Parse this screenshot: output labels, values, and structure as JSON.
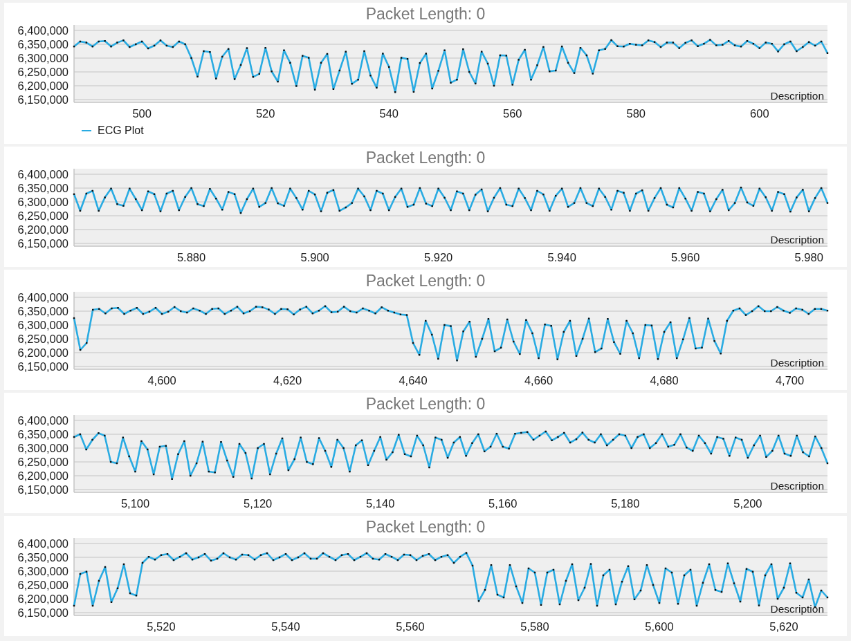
{
  "charts": [
    {
      "title": "Packet Length: 0",
      "description": "Description",
      "chart_data": {
        "type": "line",
        "x": [
          489,
          490,
          491,
          492,
          493,
          494,
          495,
          496,
          497,
          498,
          499,
          500,
          501,
          502,
          503,
          504,
          505,
          506,
          507,
          508,
          509,
          510,
          511,
          512,
          513,
          514,
          515,
          516,
          517,
          518,
          519,
          520,
          521,
          522,
          523,
          524,
          525,
          526,
          527,
          528,
          529,
          530,
          531,
          532,
          533,
          534,
          535,
          536,
          537,
          538,
          539,
          540,
          541,
          542,
          543,
          544,
          545,
          546,
          547,
          548,
          549,
          550,
          551,
          552,
          553,
          554,
          555,
          556,
          557,
          558,
          559,
          560,
          561,
          562,
          563,
          564,
          565,
          566,
          567,
          568,
          569,
          570,
          571,
          572,
          573,
          574,
          575,
          576,
          577,
          578,
          579,
          580,
          581,
          582,
          583,
          584,
          585,
          586,
          587,
          588,
          589,
          590,
          591,
          592,
          593,
          594,
          595,
          596,
          597,
          598,
          599,
          600,
          601,
          602,
          603,
          604,
          605,
          606,
          607,
          608,
          609,
          610,
          611
        ],
        "series": [
          {
            "name": "ECG Plot",
            "color": "#29abe2",
            "marker": true,
            "values": [
              6342000,
              6360000,
              6356000,
              6342000,
              6360000,
              6362000,
              6342000,
              6356000,
              6364000,
              6340000,
              6350000,
              6360000,
              6335000,
              6345000,
              6364000,
              6345000,
              6340000,
              6360000,
              6350000,
              6300000,
              6233000,
              6325000,
              6322000,
              6226000,
              6305000,
              6333000,
              6224000,
              6275000,
              6336000,
              6232000,
              6243000,
              6337000,
              6252000,
              6215000,
              6328000,
              6283000,
              6199000,
              6308000,
              6301000,
              6186000,
              6283000,
              6315000,
              6188000,
              6255000,
              6323000,
              6207000,
              6222000,
              6325000,
              6237000,
              6193000,
              6316000,
              6268000,
              6177000,
              6301000,
              6297000,
              6178000,
              6282000,
              6316000,
              6190000,
              6254000,
              6328000,
              6211000,
              6222000,
              6332000,
              6250000,
              6208000,
              6323000,
              6280000,
              6200000,
              6310000,
              6309000,
              6204000,
              6294000,
              6330000,
              6222000,
              6274000,
              6340000,
              6252000,
              6255000,
              6342000,
              6283000,
              6246000,
              6337000,
              6310000,
              6244000,
              6328000,
              6333000,
              6365000,
              6343000,
              6342000,
              6352000,
              6348000,
              6346000,
              6364000,
              6358000,
              6340000,
              6356000,
              6356000,
              6336000,
              6355000,
              6364000,
              6343000,
              6352000,
              6366000,
              6346000,
              6348000,
              6362000,
              6346000,
              6342000,
              6362000,
              6352000,
              6336000,
              6356000,
              6352000,
              6324000,
              6350000,
              6360000,
              6325000,
              6340000,
              6358000,
              6345000,
              6360000,
              6318000
            ]
          }
        ],
        "grid": true,
        "xlim": [
          489,
          611
        ],
        "ylim": [
          6140000,
          6420000
        ],
        "xticks": [
          500,
          520,
          540,
          560,
          580,
          600
        ],
        "yticks": [
          {
            "value": 6150000,
            "label": "6,150,000"
          },
          {
            "value": 6200000,
            "label": "6,200,000"
          },
          {
            "value": 6250000,
            "label": "6,250,000"
          },
          {
            "value": 6300000,
            "label": "6,300,000"
          },
          {
            "value": 6350000,
            "label": "6,350,000"
          },
          {
            "value": 6400000,
            "label": "6,400,000"
          }
        ]
      }
    },
    {
      "title": "Packet Length: 0",
      "description": "Description",
      "chart_data": {
        "type": "line",
        "x": [
          5.861,
          5.862,
          5.863,
          5.864,
          5.865,
          5.866,
          5.867,
          5.868,
          5.869,
          5.87,
          5.871,
          5.872,
          5.873,
          5.874,
          5.875,
          5.876,
          5.877,
          5.878,
          5.879,
          5.88,
          5.881,
          5.882,
          5.883,
          5.884,
          5.885,
          5.886,
          5.887,
          5.888,
          5.889,
          5.89,
          5.891,
          5.892,
          5.893,
          5.894,
          5.895,
          5.896,
          5.897,
          5.898,
          5.899,
          5.9,
          5.901,
          5.902,
          5.903,
          5.904,
          5.905,
          5.906,
          5.907,
          5.908,
          5.909,
          5.91,
          5.911,
          5.912,
          5.913,
          5.914,
          5.915,
          5.916,
          5.917,
          5.918,
          5.919,
          5.92,
          5.921,
          5.922,
          5.923,
          5.924,
          5.925,
          5.926,
          5.927,
          5.928,
          5.929,
          5.93,
          5.931,
          5.932,
          5.933,
          5.934,
          5.935,
          5.936,
          5.937,
          5.938,
          5.939,
          5.94,
          5.941,
          5.942,
          5.943,
          5.944,
          5.945,
          5.946,
          5.947,
          5.948,
          5.949,
          5.95,
          5.951,
          5.952,
          5.953,
          5.954,
          5.955,
          5.956,
          5.957,
          5.958,
          5.959,
          5.96,
          5.961,
          5.962,
          5.963,
          5.964,
          5.965,
          5.966,
          5.967,
          5.968,
          5.969,
          5.97,
          5.971,
          5.972,
          5.973,
          5.974,
          5.975,
          5.976,
          5.977,
          5.978,
          5.979,
          5.98,
          5.981,
          5.982,
          5.983
        ],
        "series": [
          {
            "color": "#29abe2",
            "marker": true,
            "values": [
              6328000,
              6268000,
              6330000,
              6340000,
              6268000,
              6316000,
              6348000,
              6292000,
              6286000,
              6348000,
              6310000,
              6270000,
              6338000,
              6328000,
              6266000,
              6330000,
              6340000,
              6270000,
              6318000,
              6350000,
              6292000,
              6285000,
              6347000,
              6312000,
              6272000,
              6336000,
              6328000,
              6260000,
              6310000,
              6348000,
              6282000,
              6296000,
              6350000,
              6295000,
              6286000,
              6348000,
              6314000,
              6272000,
              6340000,
              6327000,
              6266000,
              6333000,
              6343000,
              6268000,
              6280000,
              6296000,
              6348000,
              6320000,
              6270000,
              6340000,
              6330000,
              6270000,
              6318000,
              6348000,
              6282000,
              6290000,
              6350000,
              6294000,
              6285000,
              6348000,
              6315000,
              6270000,
              6338000,
              6330000,
              6270000,
              6326000,
              6345000,
              6266000,
              6315000,
              6350000,
              6290000,
              6285000,
              6348000,
              6314000,
              6270000,
              6340000,
              6327000,
              6268000,
              6322000,
              6348000,
              6282000,
              6296000,
              6350000,
              6296000,
              6285000,
              6348000,
              6318000,
              6272000,
              6340000,
              6333000,
              6268000,
              6330000,
              6342000,
              6268000,
              6314000,
              6350000,
              6290000,
              6280000,
              6350000,
              6312000,
              6268000,
              6336000,
              6330000,
              6266000,
              6310000,
              6344000,
              6270000,
              6296000,
              6352000,
              6298000,
              6286000,
              6348000,
              6317000,
              6268000,
              6336000,
              6328000,
              6265000,
              6316000,
              6344000,
              6266000,
              6314000,
              6350000,
              6296000
            ]
          }
        ],
        "grid": true,
        "xlim": [
          5.861,
          5.983
        ],
        "ylim": [
          6140000,
          6420000
        ],
        "xticks": [
          {
            "value": 5.88,
            "label": "5.880"
          },
          {
            "value": 5.9,
            "label": "5.900"
          },
          {
            "value": 5.92,
            "label": "5.920"
          },
          {
            "value": 5.94,
            "label": "5.940"
          },
          {
            "value": 5.96,
            "label": "5.960"
          },
          {
            "value": 5.98,
            "label": "5.980"
          }
        ],
        "yticks": [
          {
            "value": 6150000,
            "label": "6,150,000"
          },
          {
            "value": 6200000,
            "label": "6,200,000"
          },
          {
            "value": 6250000,
            "label": "6,250,000"
          },
          {
            "value": 6300000,
            "label": "6,300,000"
          },
          {
            "value": 6350000,
            "label": "6,350,000"
          },
          {
            "value": 6400000,
            "label": "6,400,000"
          }
        ]
      }
    },
    {
      "title": "Packet Length: 0",
      "description": "Description",
      "chart_data": {
        "type": "line",
        "x": [
          4586,
          4587,
          4588,
          4589,
          4590,
          4591,
          4592,
          4593,
          4594,
          4595,
          4596,
          4597,
          4598,
          4599,
          4600,
          4601,
          4602,
          4603,
          4604,
          4605,
          4606,
          4607,
          4608,
          4609,
          4610,
          4611,
          4612,
          4613,
          4614,
          4615,
          4616,
          4617,
          4618,
          4619,
          4620,
          4621,
          4622,
          4623,
          4624,
          4625,
          4626,
          4627,
          4628,
          4629,
          4630,
          4631,
          4632,
          4633,
          4634,
          4635,
          4636,
          4637,
          4638,
          4639,
          4640,
          4641,
          4642,
          4643,
          4644,
          4645,
          4646,
          4647,
          4648,
          4649,
          4650,
          4651,
          4652,
          4653,
          4654,
          4655,
          4656,
          4657,
          4658,
          4659,
          4660,
          4661,
          4662,
          4663,
          4664,
          4665,
          4666,
          4667,
          4668,
          4669,
          4670,
          4671,
          4672,
          4673,
          4674,
          4675,
          4676,
          4677,
          4678,
          4679,
          4680,
          4681,
          4682,
          4683,
          4684,
          4685,
          4686,
          4687,
          4688,
          4689,
          4690,
          4691,
          4692,
          4693,
          4694,
          4695,
          4696,
          4697,
          4698,
          4699,
          4700,
          4701,
          4702,
          4703,
          4704,
          4705,
          4706
        ],
        "series": [
          {
            "color": "#29abe2",
            "marker": true,
            "values": [
              6325000,
              6210000,
              6235000,
              6355000,
              6358000,
              6342000,
              6360000,
              6362000,
              6340000,
              6352000,
              6362000,
              6340000,
              6348000,
              6362000,
              6340000,
              6348000,
              6365000,
              6350000,
              6345000,
              6360000,
              6352000,
              6340000,
              6358000,
              6360000,
              6340000,
              6352000,
              6366000,
              6342000,
              6350000,
              6366000,
              6364000,
              6356000,
              6340000,
              6358000,
              6357000,
              6338000,
              6356000,
              6366000,
              6342000,
              6352000,
              6368000,
              6346000,
              6348000,
              6366000,
              6350000,
              6345000,
              6360000,
              6352000,
              6342000,
              6364000,
              6352000,
              6345000,
              6338000,
              6336000,
              6235000,
              6192000,
              6315000,
              6265000,
              6178000,
              6300000,
              6296000,
              6172000,
              6277000,
              6312000,
              6185000,
              6250000,
              6322000,
              6205000,
              6218000,
              6320000,
              6240000,
              6195000,
              6318000,
              6270000,
              6180000,
              6302000,
              6297000,
              6176000,
              6275000,
              6315000,
              6188000,
              6250000,
              6323000,
              6202000,
              6215000,
              6322000,
              6238000,
              6196000,
              6315000,
              6270000,
              6180000,
              6300000,
              6298000,
              6177000,
              6275000,
              6310000,
              6180000,
              6248000,
              6325000,
              6215000,
              6218000,
              6323000,
              6242000,
              6197000,
              6315000,
              6352000,
              6360000,
              6336000,
              6350000,
              6368000,
              6350000,
              6350000,
              6365000,
              6352000,
              6344000,
              6360000,
              6355000,
              6340000,
              6358000,
              6358000,
              6352000
            ]
          }
        ],
        "grid": true,
        "xlim": [
          4586,
          4706
        ],
        "ylim": [
          6140000,
          6420000
        ],
        "xticks": [
          {
            "value": 4600,
            "label": "4,600"
          },
          {
            "value": 4620,
            "label": "4,620"
          },
          {
            "value": 4640,
            "label": "4,640"
          },
          {
            "value": 4660,
            "label": "4,660"
          },
          {
            "value": 4680,
            "label": "4,680"
          },
          {
            "value": 4700,
            "label": "4,700"
          }
        ],
        "yticks": [
          {
            "value": 6150000,
            "label": "6,150,000"
          },
          {
            "value": 6200000,
            "label": "6,200,000"
          },
          {
            "value": 6250000,
            "label": "6,250,000"
          },
          {
            "value": 6300000,
            "label": "6,300,000"
          },
          {
            "value": 6350000,
            "label": "6,350,000"
          },
          {
            "value": 6400000,
            "label": "6,400,000"
          }
        ]
      }
    },
    {
      "title": "Packet Length: 0",
      "description": "Description",
      "chart_data": {
        "type": "line",
        "x": [
          5090,
          5091,
          5092,
          5093,
          5094,
          5095,
          5096,
          5097,
          5098,
          5099,
          5100,
          5101,
          5102,
          5103,
          5104,
          5105,
          5106,
          5107,
          5108,
          5109,
          5110,
          5111,
          5112,
          5113,
          5114,
          5115,
          5116,
          5117,
          5118,
          5119,
          5120,
          5121,
          5122,
          5123,
          5124,
          5125,
          5126,
          5127,
          5128,
          5129,
          5130,
          5131,
          5132,
          5133,
          5134,
          5135,
          5136,
          5137,
          5138,
          5139,
          5140,
          5141,
          5142,
          5143,
          5144,
          5145,
          5146,
          5147,
          5148,
          5149,
          5150,
          5151,
          5152,
          5153,
          5154,
          5155,
          5156,
          5157,
          5158,
          5159,
          5160,
          5161,
          5162,
          5163,
          5164,
          5165,
          5166,
          5167,
          5168,
          5169,
          5170,
          5171,
          5172,
          5173,
          5174,
          5175,
          5176,
          5177,
          5178,
          5179,
          5180,
          5181,
          5182,
          5183,
          5184,
          5185,
          5186,
          5187,
          5188,
          5189,
          5190,
          5191,
          5192,
          5193,
          5194,
          5195,
          5196,
          5197,
          5198,
          5199,
          5200,
          5201,
          5202,
          5203,
          5204,
          5205,
          5206,
          5207,
          5208,
          5209,
          5210,
          5211,
          5212,
          5213
        ],
        "series": [
          {
            "color": "#29abe2",
            "marker": true,
            "values": [
              6340000,
              6350000,
              6295000,
              6330000,
              6354000,
              6345000,
              6250000,
              6245000,
              6338000,
              6270000,
              6215000,
              6325000,
              6295000,
              6205000,
              6305000,
              6308000,
              6188000,
              6278000,
              6325000,
              6200000,
              6245000,
              6323000,
              6215000,
              6212000,
              6322000,
              6255000,
              6196000,
              6315000,
              6282000,
              6190000,
              6300000,
              6315000,
              6205000,
              6280000,
              6335000,
              6220000,
              6260000,
              6338000,
              6250000,
              6242000,
              6336000,
              6290000,
              6232000,
              6330000,
              6300000,
              6215000,
              6310000,
              6328000,
              6238000,
              6290000,
              6340000,
              6258000,
              6285000,
              6348000,
              6278000,
              6270000,
              6345000,
              6310000,
              6230000,
              6338000,
              6330000,
              6265000,
              6320000,
              6340000,
              6272000,
              6318000,
              6350000,
              6288000,
              6305000,
              6352000,
              6305000,
              6298000,
              6352000,
              6355000,
              6358000,
              6330000,
              6345000,
              6360000,
              6328000,
              6340000,
              6355000,
              6320000,
              6332000,
              6356000,
              6330000,
              6320000,
              6350000,
              6310000,
              6330000,
              6350000,
              6345000,
              6300000,
              6340000,
              6350000,
              6300000,
              6318000,
              6350000,
              6305000,
              6312000,
              6350000,
              6302000,
              6290000,
              6345000,
              6318000,
              6280000,
              6340000,
              6334000,
              6272000,
              6338000,
              6330000,
              6265000,
              6310000,
              6345000,
              6268000,
              6290000,
              6345000,
              6280000,
              6272000,
              6345000,
              6285000,
              6270000,
              6342000,
              6300000,
              6245000
            ]
          }
        ],
        "grid": true,
        "xlim": [
          5090,
          5213
        ],
        "ylim": [
          6140000,
          6420000
        ],
        "xticks": [
          {
            "value": 5100,
            "label": "5,100"
          },
          {
            "value": 5120,
            "label": "5,120"
          },
          {
            "value": 5140,
            "label": "5,140"
          },
          {
            "value": 5160,
            "label": "5,160"
          },
          {
            "value": 5180,
            "label": "5,180"
          },
          {
            "value": 5200,
            "label": "5,200"
          }
        ],
        "yticks": [
          {
            "value": 6150000,
            "label": "6,150,000"
          },
          {
            "value": 6200000,
            "label": "6,200,000"
          },
          {
            "value": 6250000,
            "label": "6,250,000"
          },
          {
            "value": 6300000,
            "label": "6,300,000"
          },
          {
            "value": 6350000,
            "label": "6,350,000"
          },
          {
            "value": 6400000,
            "label": "6,400,000"
          }
        ]
      }
    },
    {
      "title": "Packet Length: 0",
      "description": "Description",
      "chart_data": {
        "type": "line",
        "x": [
          5506,
          5507,
          5508,
          5509,
          5510,
          5511,
          5512,
          5513,
          5514,
          5515,
          5516,
          5517,
          5518,
          5519,
          5520,
          5521,
          5522,
          5523,
          5524,
          5525,
          5526,
          5527,
          5528,
          5529,
          5530,
          5531,
          5532,
          5533,
          5534,
          5535,
          5536,
          5537,
          5538,
          5539,
          5540,
          5541,
          5542,
          5543,
          5544,
          5545,
          5546,
          5547,
          5548,
          5549,
          5550,
          5551,
          5552,
          5553,
          5554,
          5555,
          5556,
          5557,
          5558,
          5559,
          5560,
          5561,
          5562,
          5563,
          5564,
          5565,
          5566,
          5567,
          5568,
          5569,
          5570,
          5571,
          5572,
          5573,
          5574,
          5575,
          5576,
          5577,
          5578,
          5579,
          5580,
          5581,
          5582,
          5583,
          5584,
          5585,
          5586,
          5587,
          5588,
          5589,
          5590,
          5591,
          5592,
          5593,
          5594,
          5595,
          5596,
          5597,
          5598,
          5599,
          5600,
          5601,
          5602,
          5603,
          5604,
          5605,
          5606,
          5607,
          5608,
          5609,
          5610,
          5611,
          5612,
          5613,
          5614,
          5615,
          5616,
          5617,
          5618,
          5619,
          5620,
          5621,
          5622,
          5623,
          5624,
          5625,
          5626,
          5627
        ],
        "series": [
          {
            "color": "#29abe2",
            "marker": true,
            "values": [
              6175000,
              6290000,
              6298000,
              6175000,
              6265000,
              6315000,
              6188000,
              6238000,
              6325000,
              6220000,
              6212000,
              6330000,
              6352000,
              6342000,
              6358000,
              6362000,
              6340000,
              6352000,
              6365000,
              6342000,
              6350000,
              6362000,
              6338000,
              6345000,
              6365000,
              6350000,
              6342000,
              6360000,
              6358000,
              6342000,
              6358000,
              6365000,
              6340000,
              6350000,
              6362000,
              6340000,
              6350000,
              6365000,
              6345000,
              6345000,
              6365000,
              6352000,
              6340000,
              6358000,
              6362000,
              6340000,
              6352000,
              6365000,
              6345000,
              6342000,
              6362000,
              6352000,
              6340000,
              6360000,
              6358000,
              6340000,
              6355000,
              6362000,
              6340000,
              6352000,
              6358000,
              6330000,
              6352000,
              6366000,
              6320000,
              6192000,
              6232000,
              6322000,
              6215000,
              6205000,
              6322000,
              6245000,
              6185000,
              6310000,
              6295000,
              6178000,
              6295000,
              6305000,
              6180000,
              6265000,
              6325000,
              6195000,
              6240000,
              6326000,
              6175000,
              6285000,
              6305000,
              6180000,
              6262000,
              6318000,
              6198000,
              6230000,
              6322000,
              6250000,
              6185000,
              6310000,
              6295000,
              6182000,
              6285000,
              6305000,
              6175000,
              6258000,
              6325000,
              6232000,
              6225000,
              6328000,
              6256000,
              6190000,
              6308000,
              6298000,
              6176000,
              6285000,
              6325000,
              6200000,
              6240000,
              6328000,
              6222000,
              6205000,
              6270000,
              6170000,
              6230000,
              6205000
            ]
          }
        ],
        "grid": true,
        "xlim": [
          5506,
          5627
        ],
        "ylim": [
          6140000,
          6420000
        ],
        "xticks": [
          {
            "value": 5520,
            "label": "5,520"
          },
          {
            "value": 5540,
            "label": "5,540"
          },
          {
            "value": 5560,
            "label": "5,560"
          },
          {
            "value": 5580,
            "label": "5,580"
          },
          {
            "value": 5600,
            "label": "5,600"
          },
          {
            "value": 5620,
            "label": "5,620"
          }
        ],
        "yticks": [
          {
            "value": 6150000,
            "label": "6,150,000"
          },
          {
            "value": 6200000,
            "label": "6,200,000"
          },
          {
            "value": 6250000,
            "label": "6,250,000"
          },
          {
            "value": 6300000,
            "label": "6,300,000"
          },
          {
            "value": 6350000,
            "label": "6,350,000"
          },
          {
            "value": 6400000,
            "label": "6,400,000"
          }
        ]
      }
    }
  ]
}
